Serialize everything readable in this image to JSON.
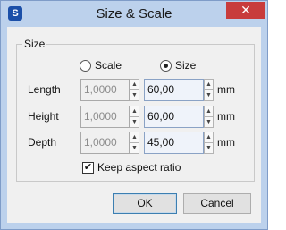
{
  "dialog": {
    "title": "Size & Scale"
  },
  "group": {
    "legend": "Size"
  },
  "mode": {
    "scale_label": "Scale",
    "size_label": "Size",
    "selected": "Size"
  },
  "rows": [
    {
      "label": "Length",
      "scale_value": "1,0000",
      "size_value": "60,00",
      "unit": "mm"
    },
    {
      "label": "Height",
      "scale_value": "1,0000",
      "size_value": "60,00",
      "unit": "mm"
    },
    {
      "label": "Depth",
      "scale_value": "1,0000",
      "size_value": "45,00",
      "unit": "mm"
    }
  ],
  "keep_aspect": {
    "label": "Keep aspect ratio",
    "checked": true
  },
  "buttons": {
    "ok": "OK",
    "cancel": "Cancel"
  },
  "colors": {
    "close_bg": "#c83c3c",
    "frame": "#bcd1ec",
    "accent": "#1b4fa8"
  },
  "icons": {
    "app": "sketchup-logo-icon",
    "close": "close-icon",
    "spin_up": "triangle-up-icon",
    "spin_down": "triangle-down-icon"
  }
}
